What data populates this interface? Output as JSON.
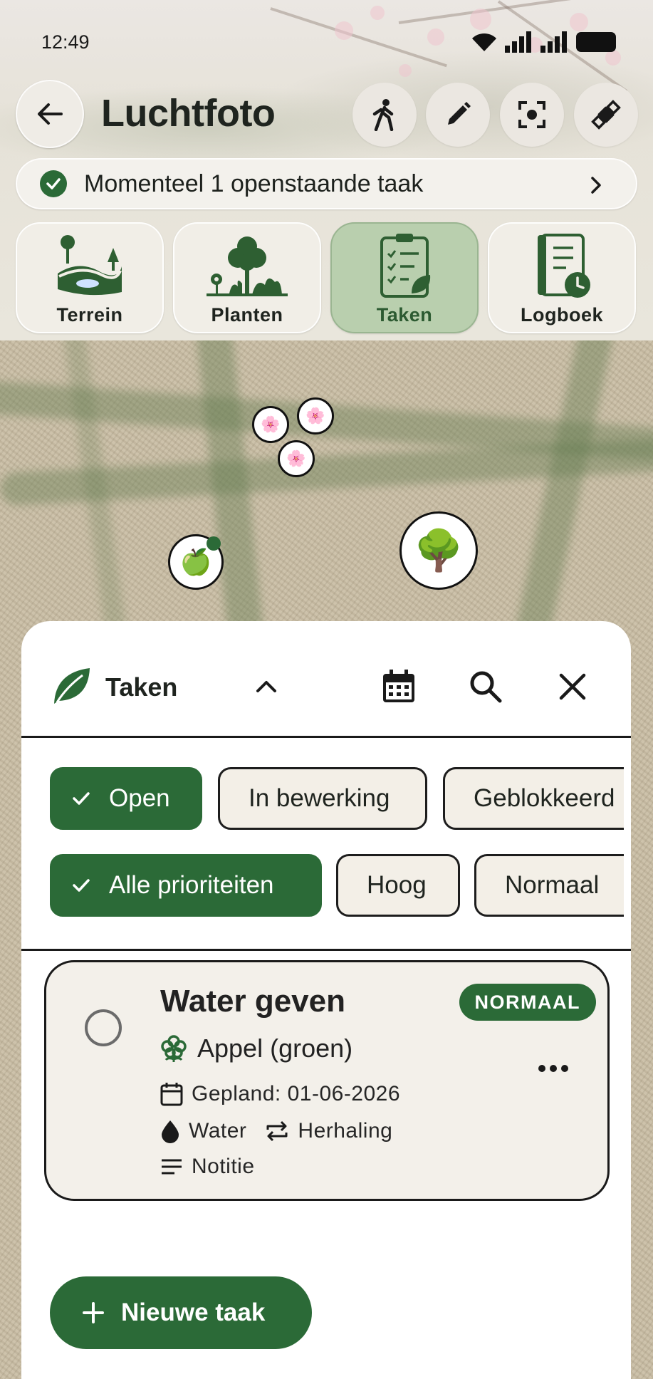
{
  "status_bar": {
    "time": "12:49"
  },
  "header": {
    "title": "Luchtfoto"
  },
  "toolbar": {
    "back_icon": "arrow-left-icon",
    "tools": [
      "walking-person-icon",
      "pencil-icon",
      "focus-center-icon",
      "satellite-icon"
    ]
  },
  "banner": {
    "text": "Momenteel 1 openstaande taak"
  },
  "nav_tiles": [
    {
      "label": "Terrein",
      "icon": "terrain-icon",
      "active": false
    },
    {
      "label": "Planten",
      "icon": "plants-icon",
      "active": false
    },
    {
      "label": "Taken",
      "icon": "clipboard-tasks-icon",
      "active": true
    },
    {
      "label": "Logboek",
      "icon": "logbook-icon",
      "active": false
    }
  ],
  "map_markers": [
    "🌸",
    "🌸",
    "🌸",
    "🍏",
    "🌳"
  ],
  "sheet": {
    "title": "Taken",
    "filters_status": [
      {
        "label": "Open",
        "selected": true
      },
      {
        "label": "In bewerking",
        "selected": false
      },
      {
        "label": "Geblokkeerd",
        "selected": false
      }
    ],
    "filters_priority": [
      {
        "label": "Alle prioriteiten",
        "selected": true
      },
      {
        "label": "Hoog",
        "selected": false
      },
      {
        "label": "Normaal",
        "selected": false
      }
    ],
    "task": {
      "title": "Water geven",
      "priority": "NORMAAL",
      "plant": "Appel (groen)",
      "planned": "Gepland: 01-06-2026",
      "type": "Water",
      "repeat": "Herhaling",
      "note": "Notitie"
    },
    "new_task_label": "Nieuwe taak"
  },
  "colors": {
    "primary": "#2b6a37",
    "active_tile": "#b9cfae",
    "card": "#f3f0ea"
  }
}
